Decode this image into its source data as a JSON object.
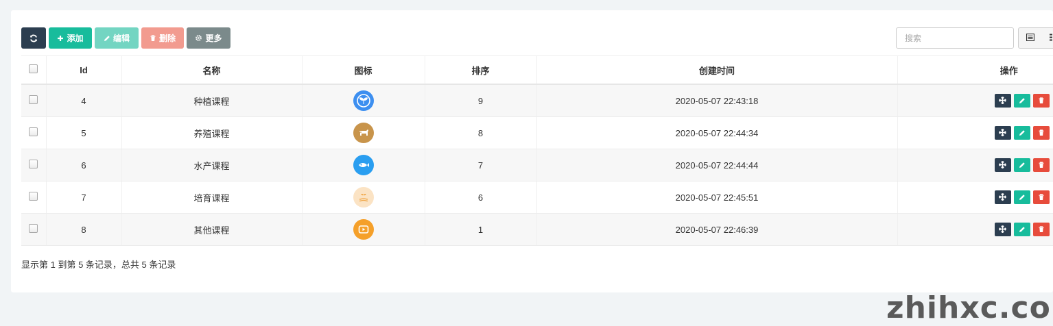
{
  "toolbar": {
    "add_label": "添加",
    "edit_label": "编辑",
    "delete_label": "删除",
    "more_label": "更多"
  },
  "search": {
    "placeholder": "搜索"
  },
  "table": {
    "columns": [
      "Id",
      "名称",
      "图标",
      "排序",
      "创建时间",
      "操作"
    ],
    "rows": [
      {
        "id": "4",
        "name": "种植课程",
        "icon": "sprout-icon",
        "icon_color": "#3d8ff0",
        "sort": "9",
        "created": "2020-05-07 22:43:18"
      },
      {
        "id": "5",
        "name": "养殖课程",
        "icon": "cow-icon",
        "icon_color": "#c8944b",
        "sort": "8",
        "created": "2020-05-07 22:44:34"
      },
      {
        "id": "6",
        "name": "水产课程",
        "icon": "fish-icon",
        "icon_color": "#2a9ef0",
        "sort": "7",
        "created": "2020-05-07 22:44:44"
      },
      {
        "id": "7",
        "name": "培育课程",
        "icon": "nursery-icon",
        "icon_color": "#fbe3c4",
        "sort": "6",
        "created": "2020-05-07 22:45:51"
      },
      {
        "id": "8",
        "name": "其他课程",
        "icon": "video-icon",
        "icon_color": "#f5a02a",
        "sort": "1",
        "created": "2020-05-07 22:46:39"
      }
    ]
  },
  "pagination": {
    "info": "显示第 1 到第 5 条记录，总共 5 条记录"
  },
  "watermark": "zhihxc.com",
  "colors": {
    "primary": "#2c3e50",
    "success": "#18bc9c",
    "danger": "#e74c3c",
    "muted": "#7b8a8b"
  }
}
